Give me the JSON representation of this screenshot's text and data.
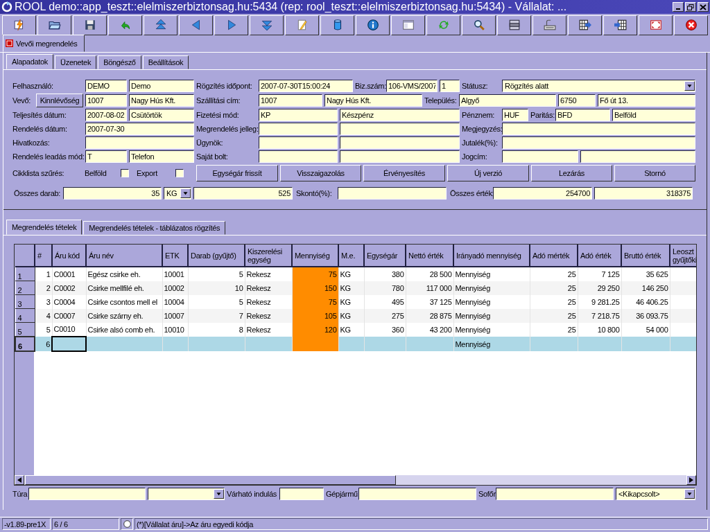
{
  "window": {
    "title": "ROOL demo::app_teszt::elelmiszerbiztonsag.hu:5434 (rep: rool_teszt::elelmiszerbiztonsag.hu:5434) - Vállalat: ..."
  },
  "document_tabs": [
    {
      "label": "Vevői megrendelés",
      "selected": true
    }
  ],
  "tabs": [
    {
      "label": "Alapadatok",
      "selected": true
    },
    {
      "label": "Üzenetek",
      "selected": false
    },
    {
      "label": "Böngésző",
      "selected": false
    },
    {
      "label": "Beállítások",
      "selected": false
    }
  ],
  "form": {
    "rows": [
      {
        "items": [
          {
            "kind": "label",
            "text": "Felhasználó:"
          },
          {
            "kind": "field",
            "value": "DEMO"
          },
          {
            "kind": "field",
            "value": "Demo"
          },
          {
            "kind": "label",
            "text": "Rögzítés időpont:"
          },
          {
            "kind": "field",
            "value": "2007-07-30T15:00:24"
          },
          {
            "kind": "label",
            "text": "Biz.szám:"
          },
          {
            "kind": "field",
            "value": "106-VMS/2007"
          },
          {
            "kind": "field",
            "value": "1"
          },
          {
            "kind": "label",
            "text": "Státusz:"
          },
          {
            "kind": "select",
            "value": "Rögzítés alatt"
          }
        ]
      },
      {
        "items": [
          {
            "kind": "label",
            "text": "Vevő:"
          },
          {
            "kind": "button",
            "label": "Kinnlévőség"
          },
          {
            "kind": "field",
            "value": "1007"
          },
          {
            "kind": "field",
            "value": "Nagy Hús Kft."
          },
          {
            "kind": "label",
            "text": "Szállítási cím:"
          },
          {
            "kind": "field",
            "value": "1007"
          },
          {
            "kind": "field",
            "value": "Nagy Hús Kft."
          },
          {
            "kind": "label",
            "text": "Település:"
          },
          {
            "kind": "field",
            "value": "Algyő"
          },
          {
            "kind": "field",
            "value": "6750"
          },
          {
            "kind": "field",
            "value": "Fő út 13."
          }
        ]
      },
      {
        "items": [
          {
            "kind": "label",
            "text": "Teljesítés dátum:"
          },
          {
            "kind": "field",
            "value": "2007-08-02"
          },
          {
            "kind": "field",
            "value": "Csütörtök"
          },
          {
            "kind": "label",
            "text": "Fizetési mód:"
          },
          {
            "kind": "field",
            "value": "KP"
          },
          {
            "kind": "field",
            "value": "Készpénz"
          },
          {
            "kind": "label",
            "text": "Pénznem:"
          },
          {
            "kind": "field",
            "value": "HUF"
          },
          {
            "kind": "label",
            "text": "Paritás:"
          },
          {
            "kind": "field",
            "value": "BFD"
          },
          {
            "kind": "field",
            "value": "Belföld"
          }
        ]
      },
      {
        "items": [
          {
            "kind": "label",
            "text": "Rendelés dátum:"
          },
          {
            "kind": "field",
            "value": "2007-07-30"
          },
          {
            "kind": "label",
            "text": "Megrendelés jelleg:"
          },
          {
            "kind": "field"
          },
          {
            "kind": "field"
          },
          {
            "kind": "label",
            "text": "Megjegyzés:"
          },
          {
            "kind": "field"
          }
        ]
      },
      {
        "items": [
          {
            "kind": "label",
            "text": "Hivatkozás:"
          },
          {
            "kind": "field"
          },
          {
            "kind": "label",
            "text": "Ügynök:"
          },
          {
            "kind": "field"
          },
          {
            "kind": "field"
          },
          {
            "kind": "label",
            "text": "Jutalék(%):"
          },
          {
            "kind": "field"
          }
        ]
      },
      {
        "items": [
          {
            "kind": "label",
            "text": "Rendelés leadás mód:"
          },
          {
            "kind": "field",
            "value": "T"
          },
          {
            "kind": "field",
            "value": "Telefon"
          },
          {
            "kind": "label",
            "text": "Saját bolt:"
          },
          {
            "kind": "field"
          },
          {
            "kind": "field"
          },
          {
            "kind": "label",
            "text": "Jogcím:"
          },
          {
            "kind": "field"
          },
          {
            "kind": "field"
          }
        ]
      },
      {
        "items": [
          {
            "kind": "label",
            "text": "Cikklista szűrés:"
          },
          {
            "kind": "label",
            "text": "Belföld"
          },
          {
            "kind": "checkbox",
            "checked": false
          },
          {
            "kind": "label",
            "text": "Export"
          },
          {
            "kind": "checkbox",
            "checked": false
          },
          {
            "kind": "button",
            "label": "Egységár frissít"
          },
          {
            "kind": "button",
            "label": "Visszaigazolás"
          },
          {
            "kind": "button",
            "label": "Érvényesítés"
          },
          {
            "kind": "button",
            "label": "Új verzió"
          },
          {
            "kind": "button",
            "label": "Lezárás"
          },
          {
            "kind": "button",
            "label": "Stornó"
          }
        ]
      },
      {
        "items": [
          {
            "kind": "label",
            "text": "Összes darab:"
          },
          {
            "kind": "number",
            "value": "35"
          },
          {
            "kind": "select",
            "value": "KG"
          },
          {
            "kind": "number",
            "value": "525"
          },
          {
            "kind": "label",
            "text": "Skontó(%):"
          },
          {
            "kind": "field"
          },
          {
            "kind": "label",
            "text": "Összes érték:"
          },
          {
            "kind": "number",
            "value": "254700"
          },
          {
            "kind": "number",
            "value": "318375"
          }
        ]
      }
    ]
  },
  "item_tabs": [
    {
      "label": "Megrendelés tételek",
      "selected": true
    },
    {
      "label": "Megrendelés tételek - táblázatos rögzítés",
      "selected": false
    }
  ],
  "table": {
    "columns": [
      {
        "label": "#",
        "numeric": true
      },
      {
        "label": "Áru kód",
        "numeric": false
      },
      {
        "label": "Áru név",
        "numeric": false
      },
      {
        "label": "ETK",
        "numeric": false
      },
      {
        "label": "Darab (gyűjtő)",
        "numeric": true
      },
      {
        "label": "Kiszerelési egység",
        "numeric": false
      },
      {
        "label": "Mennyiség",
        "numeric": true,
        "color": "#ff8c00"
      },
      {
        "label": "M.e.",
        "numeric": false
      },
      {
        "label": "Egységár",
        "numeric": true
      },
      {
        "label": "Nettó érték",
        "numeric": true
      },
      {
        "label": "Irányadó mennyiség",
        "numeric": false
      },
      {
        "label": "Adó mérték",
        "numeric": true
      },
      {
        "label": "Adó érték",
        "numeric": true
      },
      {
        "label": "Bruttó érték",
        "numeric": true
      },
      {
        "label": "Leoszt gyűjtőki",
        "numeric": true
      }
    ],
    "rows": [
      {
        "gutter": "1",
        "selected": false,
        "cells": [
          "1",
          "C0001",
          "Egész csirke eh.",
          "10001",
          "5",
          "Rekesz",
          "75",
          "KG",
          "380",
          "28 500",
          "Mennyiség",
          "25",
          "7 125",
          "35 625",
          null
        ]
      },
      {
        "gutter": "2",
        "selected": false,
        "cells": [
          "2",
          "C0002",
          "Csirke mellfilé eh.",
          "10002",
          "10",
          "Rekesz",
          "150",
          "KG",
          "780",
          "117 000",
          "Mennyiség",
          "25",
          "29 250",
          "146 250",
          null
        ]
      },
      {
        "gutter": "3",
        "selected": false,
        "cells": [
          "3",
          "C0004",
          "Csirke csontos mell el",
          "10004",
          "5",
          "Rekesz",
          "75",
          "KG",
          "495",
          "37 125",
          "Mennyiség",
          "25",
          "9 281.25",
          "46 406.25",
          null
        ]
      },
      {
        "gutter": "4",
        "selected": false,
        "cells": [
          "4",
          "C0007",
          "Csirke szárny eh.",
          "10007",
          "7",
          "Rekesz",
          "105",
          "KG",
          "275",
          "28 875",
          "Mennyiség",
          "25",
          "7 218.75",
          "36 093.75",
          null
        ]
      },
      {
        "gutter": "5",
        "selected": false,
        "cells": [
          "5",
          "C0010",
          "Csirke alsó comb eh.",
          "10010",
          "8",
          "Rekesz",
          "120",
          "KG",
          "360",
          "43 200",
          "Mennyiség",
          "25",
          "10 800",
          "54 000",
          null
        ]
      },
      {
        "gutter": "6",
        "selected": true,
        "cells": [
          "6",
          null,
          null,
          null,
          null,
          null,
          null,
          null,
          null,
          null,
          "Mennyiség",
          null,
          null,
          null,
          null
        ]
      }
    ]
  },
  "trip_bar": {
    "items": [
      {
        "kind": "label",
        "text": "Túra"
      },
      {
        "kind": "field"
      },
      {
        "kind": "select"
      },
      {
        "kind": "label",
        "text": "Várható indulás"
      },
      {
        "kind": "field"
      },
      {
        "kind": "label",
        "text": "Gépjármű"
      },
      {
        "kind": "field"
      },
      {
        "kind": "label",
        "text": "Sofőr"
      },
      {
        "kind": "field"
      },
      {
        "kind": "select",
        "value": "<Kikapcsolt>"
      }
    ]
  },
  "status_bar": {
    "version": "-v1.89-pre1X",
    "record": "6 / 6",
    "message": "(*)[Vállalat áru]->Az áru egyedi kódja"
  }
}
